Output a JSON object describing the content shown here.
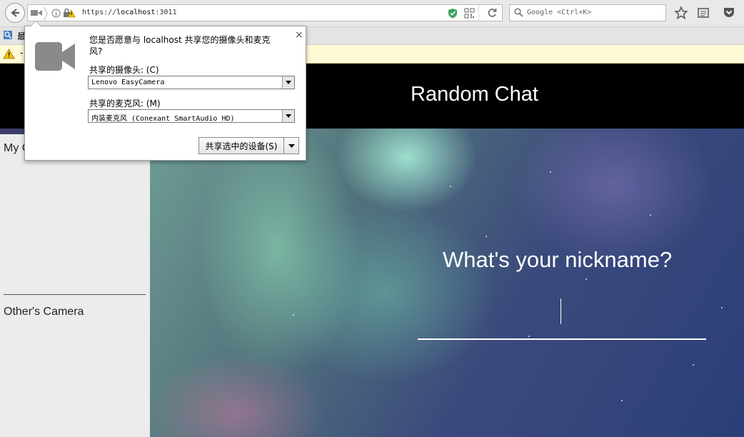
{
  "browser": {
    "url_prefix": "https://",
    "url_host": "localhost",
    "url_port": ":3011",
    "search_placeholder": "Google <Ctrl+K>",
    "bookmarks_text": "最",
    "notification_text": "-"
  },
  "permission": {
    "message": "您是否愿意与 localhost 共享您的摄像头和麦克风?",
    "camera_label": "共享的摄像头: (C)",
    "camera_value": "Lenovo EasyCamera",
    "mic_label": "共享的麦克风: (M)",
    "mic_value": "内装麦克风 (Conexant SmartAudio HD)",
    "share_button": "共享选中的设备(S)",
    "close_glyph": "×"
  },
  "page": {
    "title": "Random Chat",
    "my_camera": "My C",
    "others_camera": "Other's Camera",
    "nickname_question": "What's your nickname?"
  },
  "colors": {
    "header_bg": "#000000",
    "sidebar_bg": "#ececec",
    "notif_bg": "#fffbd6"
  }
}
